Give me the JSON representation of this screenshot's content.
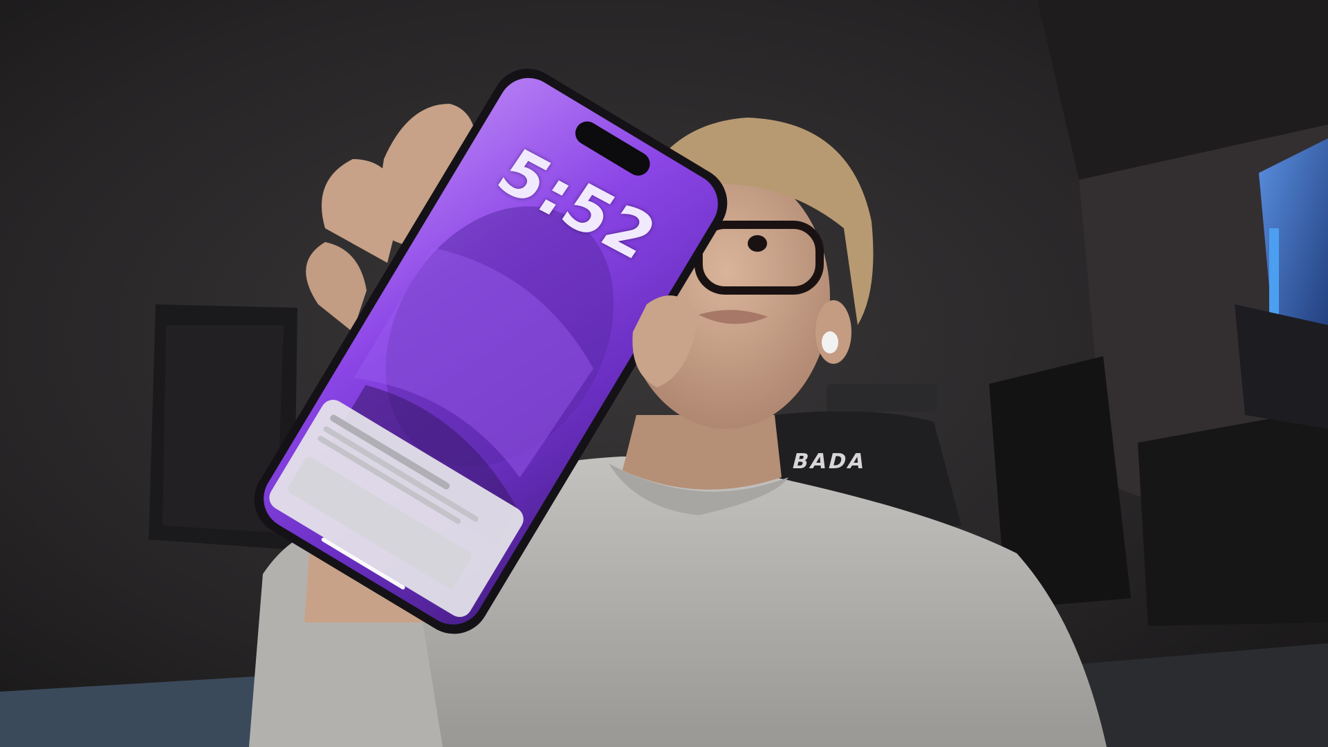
{
  "scene": {
    "description_type": "webcam-photo",
    "phone": {
      "lock_screen_time": "5:52",
      "wallpaper_tone": "#7a3fd6"
    },
    "chair": {
      "brand_text": "BADA"
    },
    "colors": {
      "wall": "#2a2829",
      "shirt": "#b9b7b4",
      "skin": "#c9a58a",
      "hair": "#b89a72",
      "screen_purple": "#8a4de8",
      "glasses": "#1a1212",
      "window_blue": "#2a4a8a"
    }
  }
}
